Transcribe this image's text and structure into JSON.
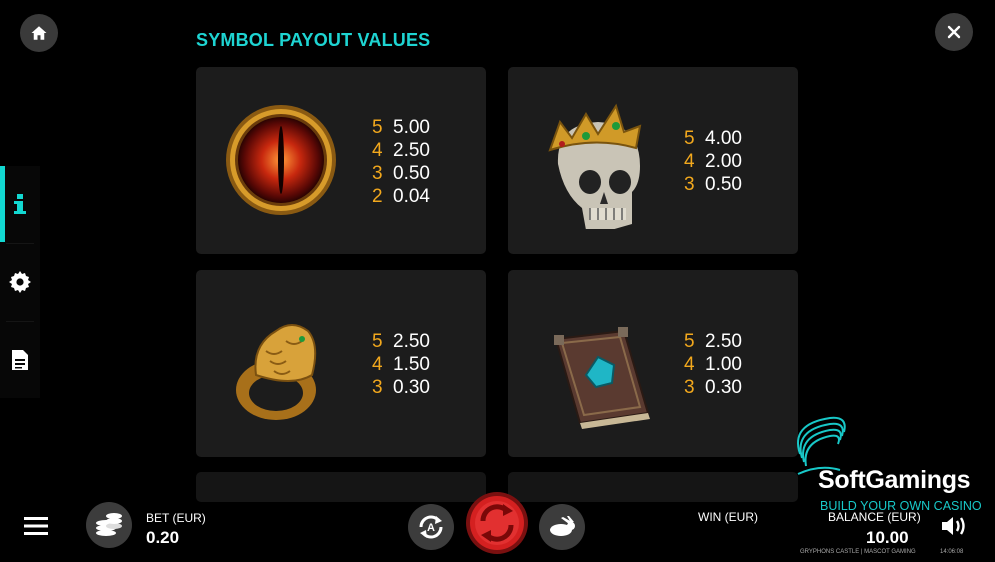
{
  "header": {
    "title": "SYMBOL PAYOUT VALUES"
  },
  "top_buttons": {
    "home_icon": "home-icon",
    "close_icon": "close-icon"
  },
  "sidebar": {
    "items": [
      {
        "id": "info",
        "icon": "info-icon",
        "active": true
      },
      {
        "id": "settings",
        "icon": "gear-icon",
        "active": false
      },
      {
        "id": "rules",
        "icon": "document-icon",
        "active": false
      }
    ]
  },
  "symbols": [
    {
      "name": "dragon-eye",
      "payouts": [
        {
          "count": "5",
          "value": "5.00"
        },
        {
          "count": "4",
          "value": "2.50"
        },
        {
          "count": "3",
          "value": "0.50"
        },
        {
          "count": "2",
          "value": "0.04"
        }
      ]
    },
    {
      "name": "crowned-skull",
      "payouts": [
        {
          "count": "5",
          "value": "4.00"
        },
        {
          "count": "4",
          "value": "2.00"
        },
        {
          "count": "3",
          "value": "0.50"
        }
      ]
    },
    {
      "name": "golden-ring",
      "payouts": [
        {
          "count": "5",
          "value": "2.50"
        },
        {
          "count": "4",
          "value": "1.50"
        },
        {
          "count": "3",
          "value": "0.30"
        }
      ]
    },
    {
      "name": "spell-book",
      "payouts": [
        {
          "count": "5",
          "value": "2.50"
        },
        {
          "count": "4",
          "value": "1.00"
        },
        {
          "count": "3",
          "value": "0.30"
        }
      ]
    }
  ],
  "bottom_bar": {
    "bet_label": "BET (EUR)",
    "bet_value": "0.20",
    "win_label": "WIN (EUR)",
    "balance_label": "BALANCE (EUR)",
    "balance_value": "10.00",
    "footer_game": "GRYPHONS CASTLE | MASCOT GAMING",
    "footer_time": "14:06:08"
  },
  "watermark": {
    "brand": "SoftGamings",
    "tagline": "BUILD YOUR OWN CASINO"
  },
  "colors": {
    "accent": "#1ed4d2",
    "payout_count": "#f2a81d",
    "card_bg": "#1c1c1c",
    "spin_red": "#d42020"
  }
}
